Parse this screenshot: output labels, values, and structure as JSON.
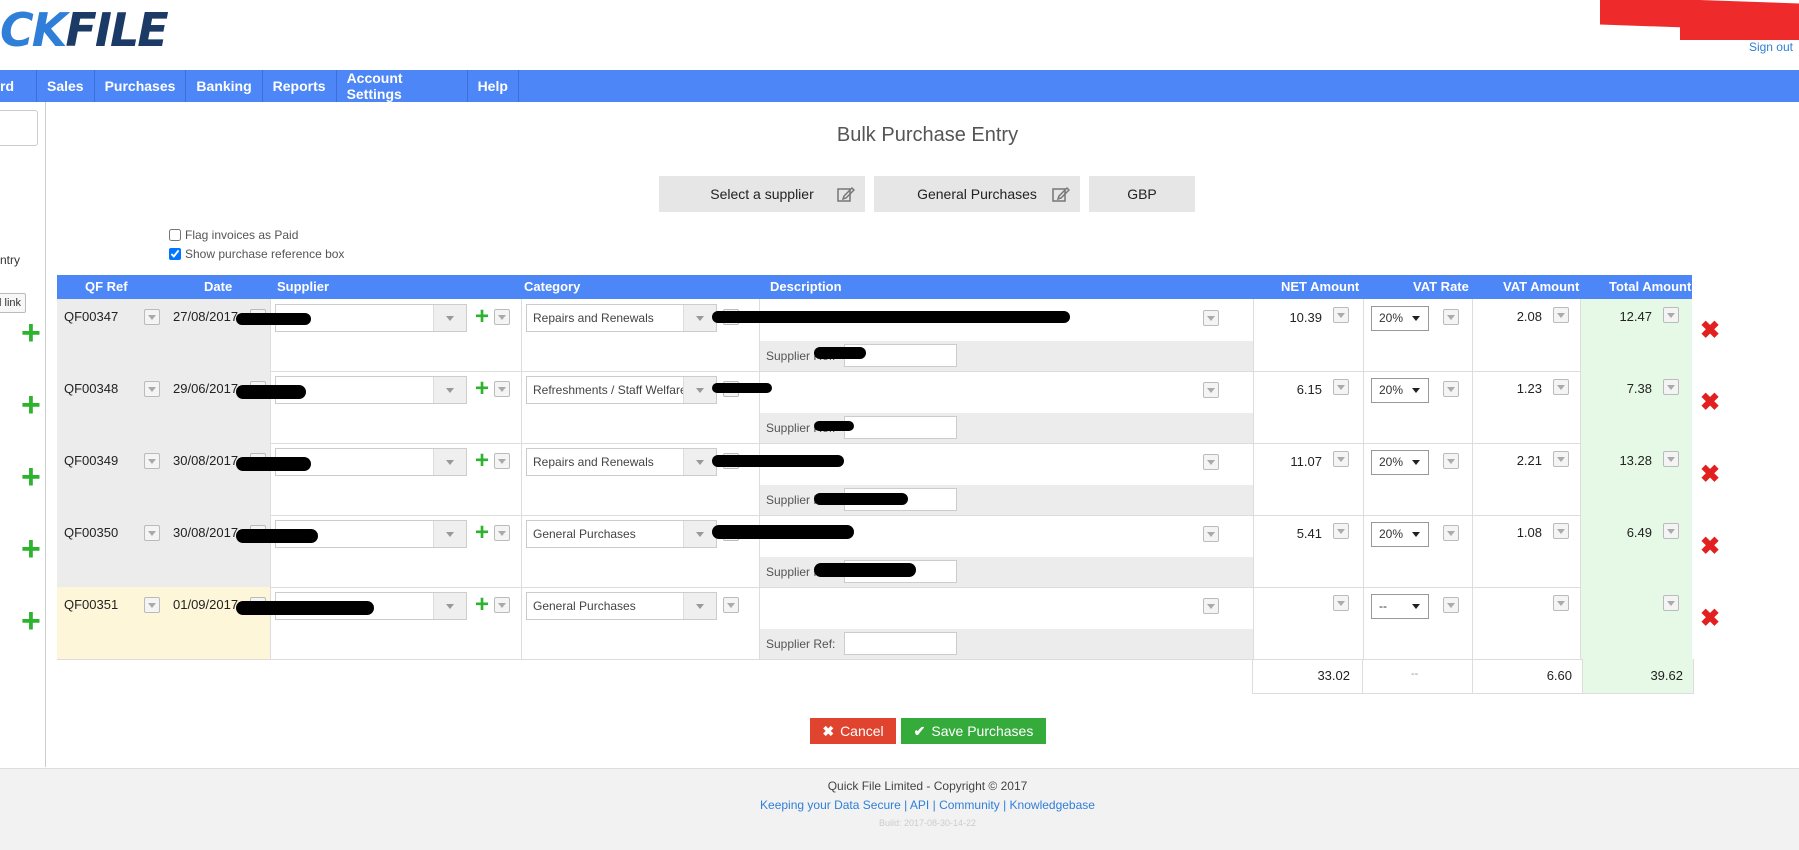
{
  "header": {
    "logo_part1": "CK",
    "logo_part2": "FILE",
    "sign_out": "Sign out"
  },
  "nav": {
    "items": [
      "rd",
      "Sales",
      "Purchases",
      "Banking",
      "Reports",
      "Account Settings",
      "Help"
    ]
  },
  "sidebar": {
    "entry_text": "ntry",
    "link_text": "l link"
  },
  "page": {
    "title": "Bulk Purchase Entry",
    "select_supplier": "Select a supplier",
    "general_purchases": "General Purchases",
    "currency": "GBP",
    "flag_paid": "Flag invoices as Paid",
    "flag_paid_checked": false,
    "show_ref_box": "Show purchase reference box",
    "show_ref_box_checked": true
  },
  "table": {
    "headers": {
      "qf_ref": "QF Ref",
      "date": "Date",
      "supplier": "Supplier",
      "category": "Category",
      "description": "Description",
      "net": "NET Amount",
      "vat_rate": "VAT Rate",
      "vat_amount": "VAT Amount",
      "total": "Total Amount"
    },
    "supplier_ref_label": "Supplier Ref:",
    "rows": [
      {
        "ref": "QF00347",
        "date": "27/08/2017",
        "category": "Repairs and Renewals",
        "net": "10.39",
        "vat_rate": "20%",
        "vat": "2.08",
        "total": "12.47"
      },
      {
        "ref": "QF00348",
        "date": "29/06/2017",
        "category": "Refreshments / Staff Welfare",
        "net": "6.15",
        "vat_rate": "20%",
        "vat": "1.23",
        "total": "7.38"
      },
      {
        "ref": "QF00349",
        "date": "30/08/2017",
        "category": "Repairs and Renewals",
        "net": "11.07",
        "vat_rate": "20%",
        "vat": "2.21",
        "total": "13.28"
      },
      {
        "ref": "QF00350",
        "date": "30/08/2017",
        "category": "General Purchases",
        "net": "5.41",
        "vat_rate": "20%",
        "vat": "1.08",
        "total": "6.49"
      },
      {
        "ref": "QF00351",
        "date": "01/09/2017",
        "category": "General Purchases",
        "net": "",
        "vat_rate": "--",
        "vat": "",
        "total": ""
      }
    ],
    "totals": {
      "net": "33.02",
      "vat_rate": "--",
      "vat": "6.60",
      "total": "39.62"
    }
  },
  "actions": {
    "cancel": "Cancel",
    "save": "Save Purchases"
  },
  "footer": {
    "copyright": "Quick File Limited - Copyright © 2017",
    "links": [
      "Keeping your Data Secure",
      "API",
      "Community",
      "Knowledgebase"
    ],
    "build": "Build: 2017-08-30-14-22"
  },
  "colors": {
    "nav": "#4d86f6",
    "add": "#2db32d",
    "delete": "#e32020",
    "cancel": "#e0442e",
    "save": "#35ab3b"
  }
}
